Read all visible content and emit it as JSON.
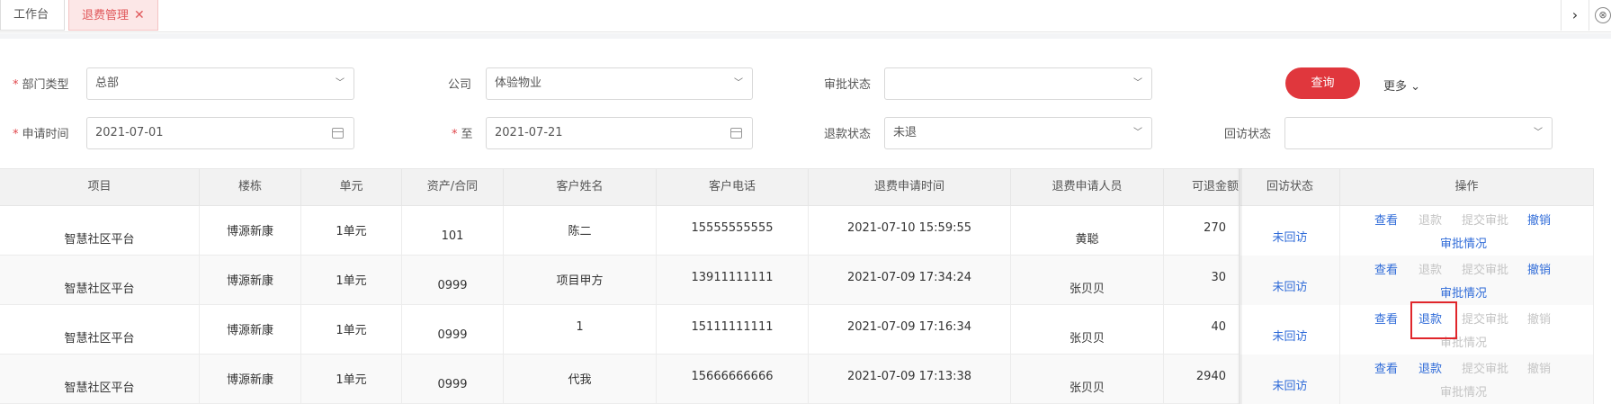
{
  "tabs": [
    {
      "label": "工作台"
    },
    {
      "label": "退费管理",
      "close": "✕"
    }
  ],
  "tab_controls": {
    "next": "›",
    "close": "⊗"
  },
  "filters": {
    "dept_type": {
      "label": "部门类型",
      "value": "总部"
    },
    "company": {
      "label": "公司",
      "value": "体验物业"
    },
    "approval_status": {
      "label": "审批状态",
      "value": ""
    },
    "apply_time": {
      "label": "申请时间",
      "value": "2021-07-01"
    },
    "to": {
      "label": "至",
      "value": "2021-07-21"
    },
    "refund_status": {
      "label": "退款状态",
      "value": "未退"
    },
    "visit_status": {
      "label": "回访状态",
      "value": ""
    },
    "query_button": "查询",
    "more": "更多"
  },
  "table": {
    "headers": [
      "项目",
      "楼栋",
      "单元",
      "资产/合同",
      "客户姓名",
      "客户电话",
      "退费申请时间",
      "退费申请人员",
      "可退金额",
      "回访状态",
      "操作"
    ],
    "rows": [
      {
        "project": "智慧社区平台",
        "building": "博源新康",
        "unit": "1单元",
        "asset": "101",
        "name": "陈二",
        "phone": "15555555555",
        "time": "2021-07-10 15:59:55",
        "person": "黄聪",
        "amount": "270",
        "visit": "未回访",
        "refund_enabled": false,
        "submit_enabled": false,
        "revoke_enabled": true
      },
      {
        "project": "智慧社区平台",
        "building": "博源新康",
        "unit": "1单元",
        "asset": "0999",
        "name": "项目甲方",
        "phone": "13911111111",
        "time": "2021-07-09 17:34:24",
        "person": "张贝贝",
        "amount": "30",
        "visit": "未回访",
        "refund_enabled": false,
        "submit_enabled": false,
        "revoke_enabled": true
      },
      {
        "project": "智慧社区平台",
        "building": "博源新康",
        "unit": "1单元",
        "asset": "0999",
        "name": "1",
        "phone": "15111111111",
        "time": "2021-07-09 17:16:34",
        "person": "张贝贝",
        "amount": "40",
        "visit": "未回访",
        "refund_enabled": true,
        "submit_enabled": false,
        "revoke_enabled": false
      },
      {
        "project": "智慧社区平台",
        "building": "博源新康",
        "unit": "1单元",
        "asset": "0999",
        "name": "代我",
        "phone": "15666666666",
        "time": "2021-07-09 17:13:38",
        "person": "张贝贝",
        "amount": "2940",
        "visit": "未回访",
        "refund_enabled": true,
        "submit_enabled": false,
        "revoke_enabled": false
      }
    ],
    "actions": {
      "view": "查看",
      "refund": "退款",
      "submit": "提交审批",
      "revoke": "撤销",
      "approval": "审批情况"
    }
  },
  "colors": {
    "accent": "#e0373d",
    "link": "#2f6bd8",
    "disabled": "#c4c4c4",
    "highlight": "#e0262b"
  }
}
